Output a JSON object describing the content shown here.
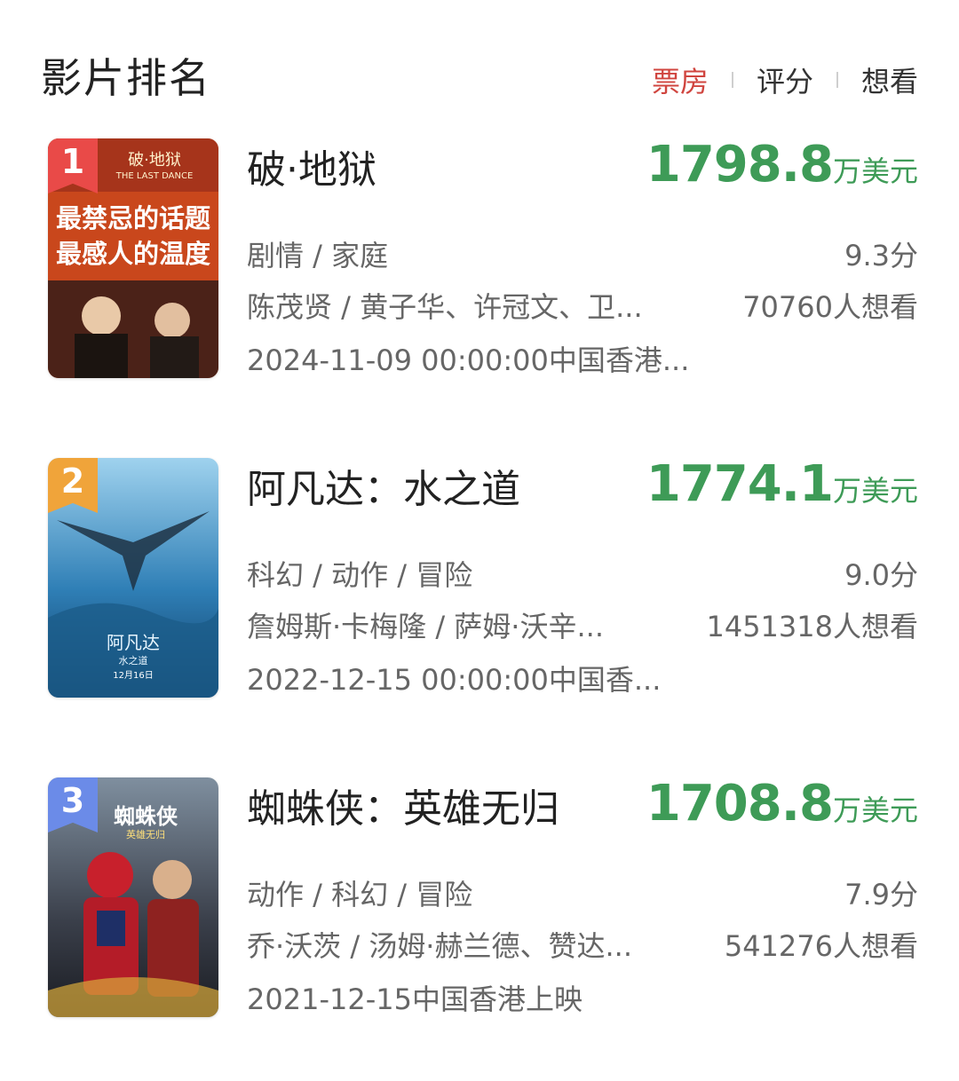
{
  "header": {
    "title": "影片排名",
    "tabs": [
      "票房",
      "评分",
      "想看"
    ],
    "active_tab": "票房"
  },
  "colors": {
    "accent_red": "#d0453f",
    "box_office_green": "#3e9b57",
    "rank1": "#e94a48",
    "rank2": "#f0a43a",
    "rank3": "#6b8be8"
  },
  "movies": [
    {
      "rank": "1",
      "name": "破·地狱",
      "box_office": "1798.8",
      "unit": "万美元",
      "genre": "剧情 / 家庭",
      "score": "9.3分",
      "cast": "陈茂贤 / 黄子华、许冠文、卫...",
      "want": "70760人想看",
      "date": "2024-11-09 00:00:00中国香港...",
      "poster_text": [
        "破·地狱",
        "THE LAST DANCE",
        "最禁忌的话题",
        "最感人的温度"
      ]
    },
    {
      "rank": "2",
      "name": "阿凡达：水之道",
      "box_office": "1774.1",
      "unit": "万美元",
      "genre": "科幻 / 动作 / 冒险",
      "score": "9.0分",
      "cast": "詹姆斯·卡梅隆 / 萨姆·沃辛...",
      "want": "1451318人想看",
      "date": "2022-12-15 00:00:00中国香...",
      "poster_text": [
        "阿凡达",
        "水之道",
        "12月16日"
      ]
    },
    {
      "rank": "3",
      "name": "蜘蛛侠：英雄无归",
      "box_office": "1708.8",
      "unit": "万美元",
      "genre": "动作 / 科幻 / 冒险",
      "score": "7.9分",
      "cast": "乔·沃茨 / 汤姆·赫兰德、赞达...",
      "want": "541276人想看",
      "date": "2021-12-15中国香港上映",
      "poster_text": [
        "蜘蛛侠",
        "英雄无归"
      ]
    }
  ]
}
